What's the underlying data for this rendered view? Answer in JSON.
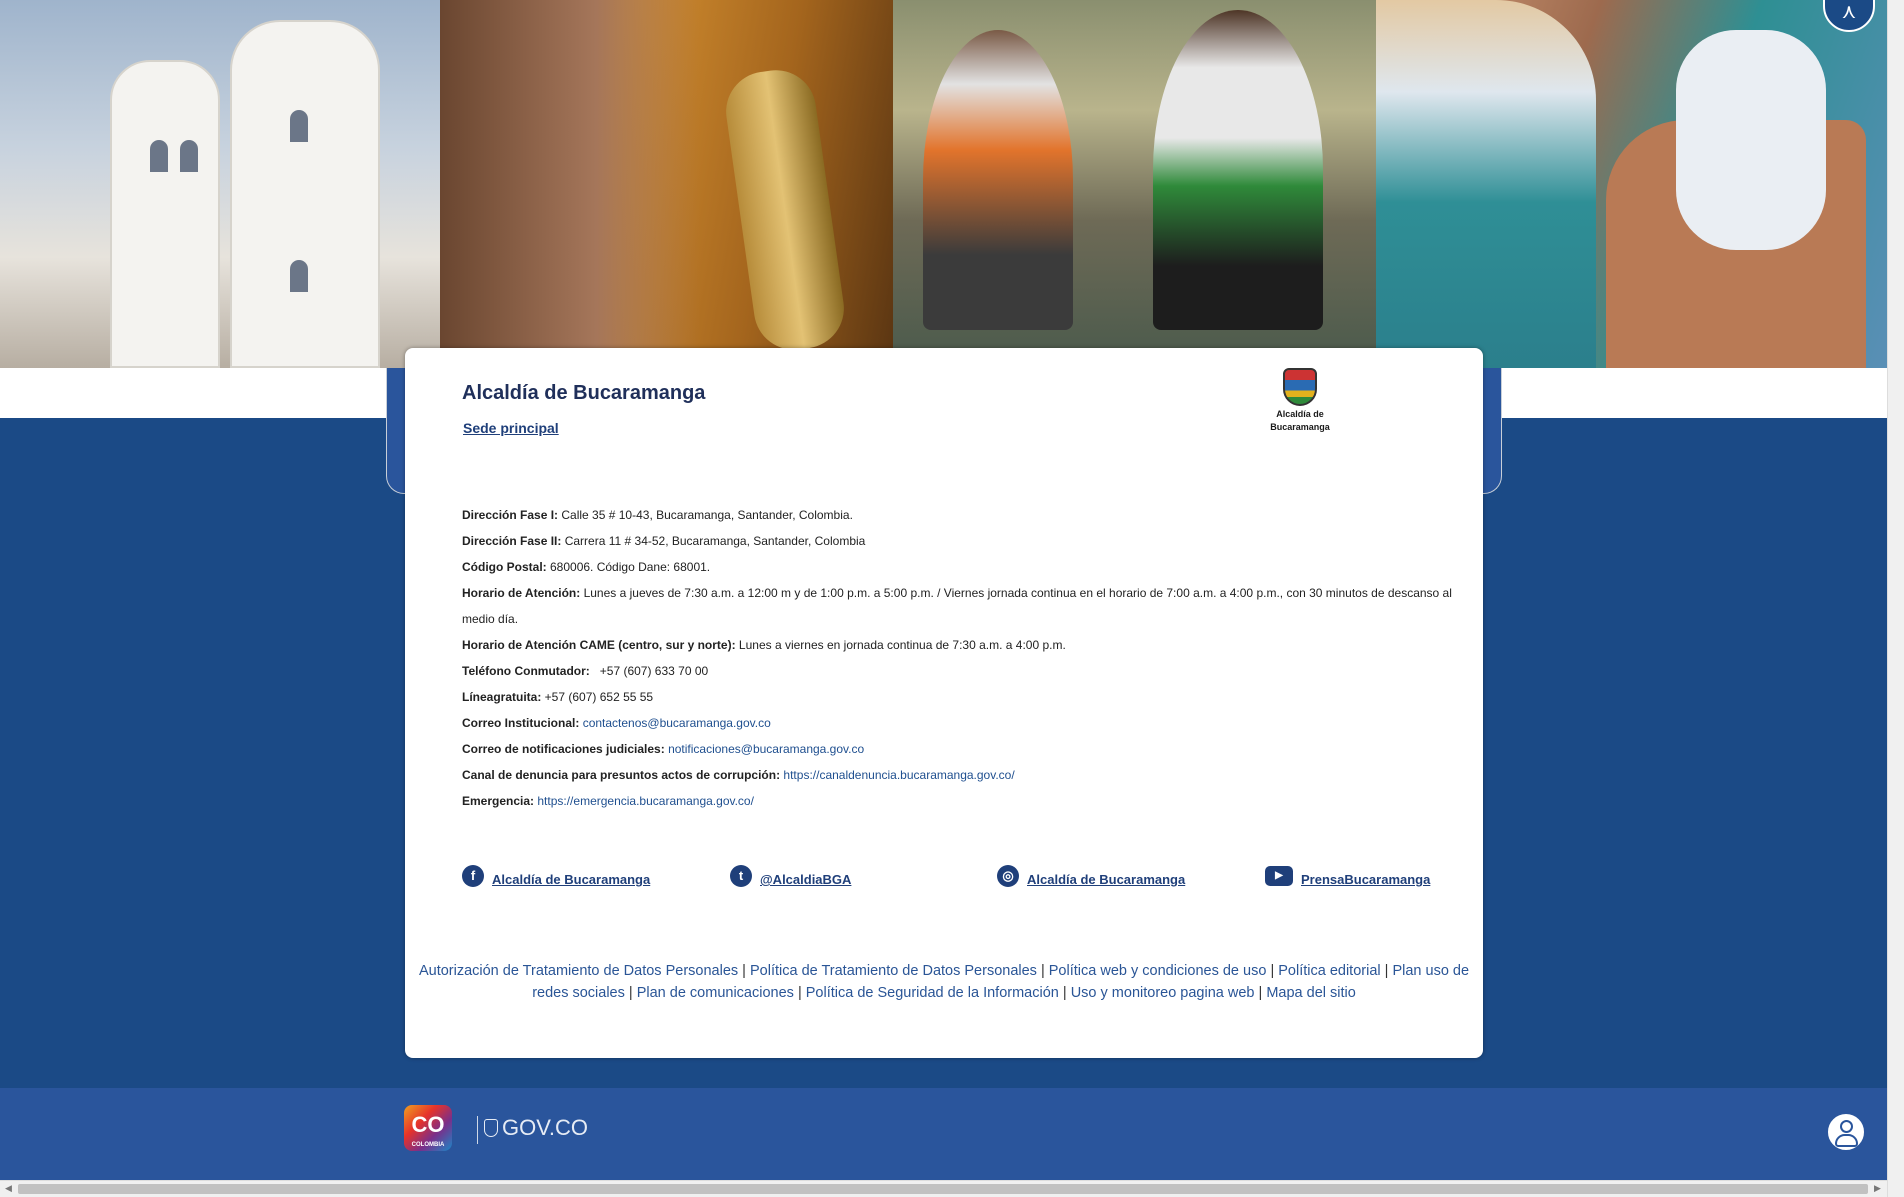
{
  "hero": {
    "photos": [
      "church-photo",
      "saxophone-photo",
      "children-photo",
      "vaccination-photo"
    ]
  },
  "accessibility": {
    "icon": "accessibility-icon"
  },
  "card": {
    "title": "Alcaldía de Bucaramanga",
    "subtitle": "Sede principal",
    "logo_text_line1": "Alcaldía de",
    "logo_text_line2": "Bucaramanga"
  },
  "info": [
    {
      "label": "Dirección Fase I:",
      "value": " Calle 35 # 10-43, Bucaramanga, Santander, Colombia."
    },
    {
      "label": "Dirección Fase II:",
      "value": " Carrera 11 # 34-52, Bucaramanga, Santander, Colombia"
    },
    {
      "label": "Código Postal:",
      "value": " 680006. Código Dane: 68001."
    },
    {
      "label": "Horario de Atención:",
      "value": " Lunes a jueves de 7:30 a.m. a 12:00 m y de 1:00 p.m. a 5:00 p.m. / Viernes jornada continua en el horario de 7:00 a.m. a 4:00 p.m., con 30 minutos de descanso al medio día."
    },
    {
      "label": "Horario de Atención CAME (centro, sur y norte):",
      "value": " Lunes a viernes en jornada continua de 7:30 a.m. a 4:00 p.m."
    },
    {
      "label": "Teléfono Conmutador:",
      "value": "   +57 (607) 633 70 00"
    },
    {
      "label": "Líneagratuita:",
      "value": " +57 (607) 652 55 55"
    },
    {
      "label": "Correo Institucional:",
      "link": "contactenos@bucaramanga.gov.co"
    },
    {
      "label": "Correo de notificaciones judiciales:",
      "link": "notificaciones@bucaramanga.gov.co"
    },
    {
      "label": "Canal de denuncia para presuntos actos de corrupción:",
      "link": "https://canaldenuncia.bucaramanga.gov.co/"
    },
    {
      "label": "Emergencia:",
      "link": "https://emergencia.bucaramanga.gov.co/"
    }
  ],
  "social": {
    "facebook": {
      "icon": "facebook-icon",
      "glyph": "f",
      "label": "Alcaldía de Bucaramanga"
    },
    "twitter": {
      "icon": "twitter-icon",
      "glyph": "t",
      "label": "@AlcaldiaBGA"
    },
    "instagram": {
      "icon": "instagram-icon",
      "glyph": "◎",
      "label": "Alcaldía de Bucaramanga"
    },
    "youtube": {
      "icon": "youtube-icon",
      "glyph": "▶",
      "label": "PrensaBucaramanga"
    }
  },
  "policy_links": [
    "Autorización de Tratamiento de Datos Personales",
    "Política de Tratamiento de Datos Personales",
    "Política web y condiciones de uso",
    "Política editorial",
    "Plan uso de redes sociales",
    "Plan de comunicaciones",
    "Política de Seguridad de la Información",
    "Uso y monitoreo pagina web",
    "Mapa del sitio"
  ],
  "footer": {
    "co_logo": "CO",
    "co_sub": "COLOMBIA",
    "gov_label": "GOV.CO",
    "user_icon": "user-icon"
  },
  "colors": {
    "page_bg": "#1b4a86",
    "footer_bg": "#2a559c",
    "link": "#1f4f8f",
    "title": "#1f2f5a"
  }
}
